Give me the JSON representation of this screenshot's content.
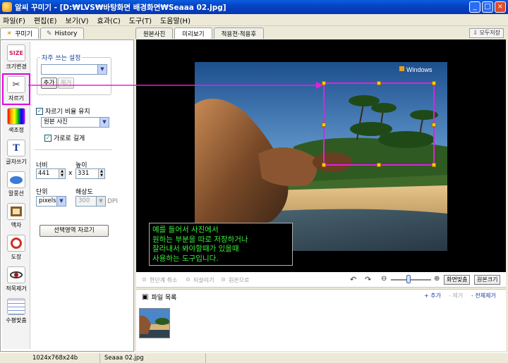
{
  "window": {
    "title": "알씨 꾸미기 - [D:₩LVS₩바탕화면 배경화면₩Seaaa 02.jpg]",
    "minimize": "_",
    "maximize": "□",
    "close": "×"
  },
  "menu": [
    "파일(F)",
    "편집(E)",
    "보기(V)",
    "효과(C)",
    "도구(T)",
    "도움말(H)"
  ],
  "left_tabs": [
    {
      "label": "꾸미기",
      "icon": "sun-icon"
    },
    {
      "label": "History",
      "icon": "pencil-icon"
    }
  ],
  "tools": [
    {
      "label": "크기변경",
      "icon": "SIZE"
    },
    {
      "label": "자르기",
      "icon": "✂"
    },
    {
      "label": "색조정",
      "icon": "▦"
    },
    {
      "label": "글자쓰기",
      "icon": "T"
    },
    {
      "label": "말풍선",
      "icon": "💬"
    },
    {
      "label": "액자",
      "icon": "▣"
    },
    {
      "label": "도장",
      "icon": "◎"
    },
    {
      "label": "적목제거",
      "icon": "👁"
    },
    {
      "label": "수평맞춤",
      "icon": "⊞"
    }
  ],
  "crop_panel": {
    "presets_title": "자주 쓰는 설정",
    "preset_value": "",
    "add_button": "추가",
    "remove_button": "제거",
    "keep_ratio_label": "자르기 비율 유지",
    "ratio_value": "원본 사진",
    "landscape_label": "가로로 길게",
    "width_label": "너비",
    "height_label": "높이",
    "width_value": "441",
    "height_value": "331",
    "times": "x",
    "unit_label": "단위",
    "unit_value": "pixels",
    "resolution_label": "해상도",
    "resolution_value": "300",
    "dpi_label": "DPI",
    "crop_button": "선택영역 자르기"
  },
  "right_tabs": [
    "원본사진",
    "미리보기",
    "적용전·적용후"
  ],
  "save_all": "모두저장",
  "preview": {
    "watermark": "Windows",
    "caption": [
      "예를 들어서 사진에서",
      "원하는 부분을 따로 저장하거나",
      "잘라내서 봐야할때가 있을때",
      "사용하는 도구입니다."
    ]
  },
  "preview_controls": {
    "undo_all": "한단계 취소",
    "redo": "되살리기",
    "original": "원본으로",
    "fit_button": "화면맞춤",
    "original_size_button": "원본크기"
  },
  "file_list": {
    "title": "파일 목록",
    "add": "+ 추가",
    "remove": "- 제거",
    "remove_all": "- 전체제거"
  },
  "status": {
    "dimensions": "1024x768x24b",
    "filename": "Seaaa 02.jpg"
  }
}
